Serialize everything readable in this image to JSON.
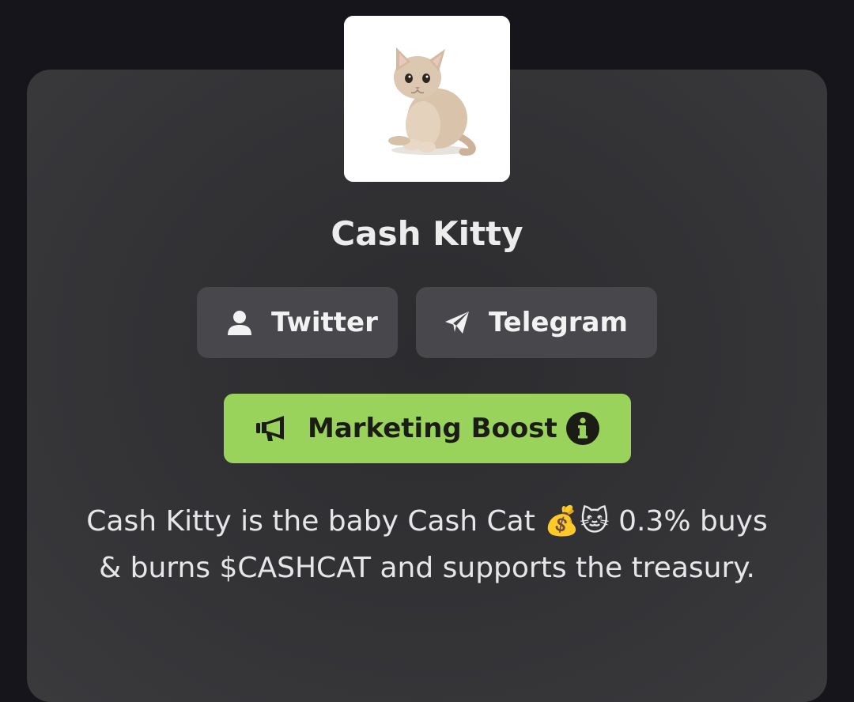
{
  "token": {
    "name": "Cash Kitty",
    "avatar_alt": "kitten-photo"
  },
  "links": {
    "twitter_label": "Twitter",
    "telegram_label": "Telegram"
  },
  "boost": {
    "label": "Marketing Boost"
  },
  "description": {
    "text": "Cash Kitty is the baby Cash Cat 💰🐱 0.3% buys & burns $CASHCAT and supports the treasury."
  },
  "colors": {
    "page_background": "#16151b",
    "card_background": "#333336",
    "social_button": "#48474b",
    "boost_button": "#99d35c"
  },
  "icons": {
    "twitter": "user-icon",
    "telegram": "paper-plane-icon",
    "boost": "megaphone-icon",
    "info": "info-circle-icon"
  }
}
